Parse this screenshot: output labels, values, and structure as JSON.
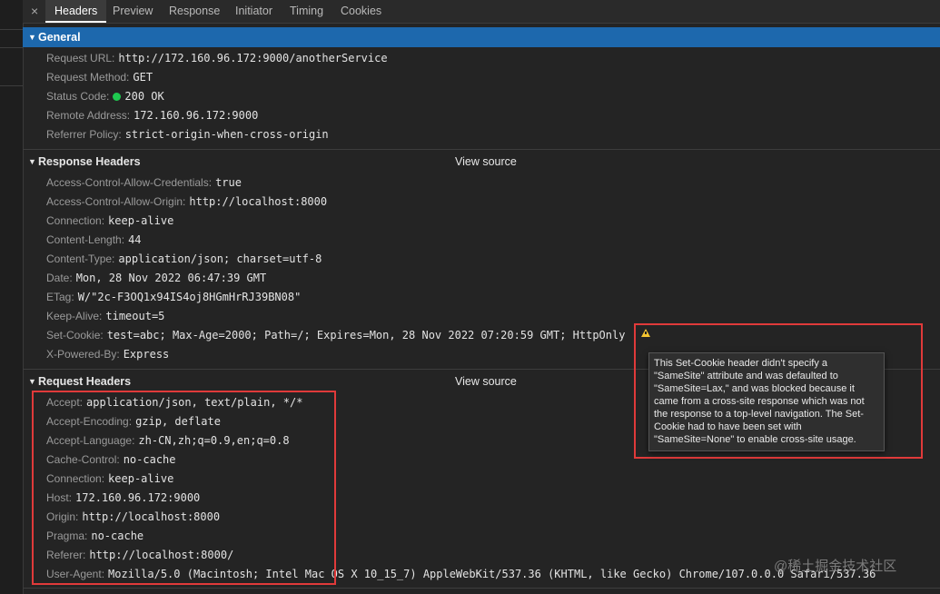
{
  "tabs": {
    "close_symbol": "×",
    "items": [
      "Headers",
      "Preview",
      "Response",
      "Initiator",
      "Timing",
      "Cookies"
    ],
    "active": "Headers"
  },
  "general": {
    "title": "General",
    "rows": [
      {
        "key": "Request URL:",
        "value": "http://172.160.96.172:9000/anotherService"
      },
      {
        "key": "Request Method:",
        "value": "GET"
      },
      {
        "key": "Status Code:",
        "value": "200 OK"
      },
      {
        "key": "Remote Address:",
        "value": "172.160.96.172:9000"
      },
      {
        "key": "Referrer Policy:",
        "value": "strict-origin-when-cross-origin"
      }
    ]
  },
  "response_headers": {
    "title": "Response Headers",
    "view_source": "View source",
    "rows": [
      {
        "key": "Access-Control-Allow-Credentials:",
        "value": "true"
      },
      {
        "key": "Access-Control-Allow-Origin:",
        "value": "http://localhost:8000"
      },
      {
        "key": "Connection:",
        "value": "keep-alive"
      },
      {
        "key": "Content-Length:",
        "value": "44"
      },
      {
        "key": "Content-Type:",
        "value": "application/json; charset=utf-8"
      },
      {
        "key": "Date:",
        "value": "Mon, 28 Nov 2022 06:47:39 GMT"
      },
      {
        "key": "ETag:",
        "value": "W/\"2c-F3OQ1x94IS4oj8HGmHrRJ39BN08\""
      },
      {
        "key": "Keep-Alive:",
        "value": "timeout=5"
      },
      {
        "key": "Set-Cookie:",
        "value": "test=abc; Max-Age=2000; Path=/; Expires=Mon, 28 Nov 2022 07:20:59 GMT; HttpOnly"
      },
      {
        "key": "X-Powered-By:",
        "value": "Express"
      }
    ]
  },
  "request_headers": {
    "title": "Request Headers",
    "view_source": "View source",
    "rows": [
      {
        "key": "Accept:",
        "value": "application/json, text/plain, */*"
      },
      {
        "key": "Accept-Encoding:",
        "value": "gzip, deflate"
      },
      {
        "key": "Accept-Language:",
        "value": "zh-CN,zh;q=0.9,en;q=0.8"
      },
      {
        "key": "Cache-Control:",
        "value": "no-cache"
      },
      {
        "key": "Connection:",
        "value": "keep-alive"
      },
      {
        "key": "Host:",
        "value": "172.160.96.172:9000"
      },
      {
        "key": "Origin:",
        "value": "http://localhost:8000"
      },
      {
        "key": "Pragma:",
        "value": "no-cache"
      },
      {
        "key": "Referer:",
        "value": "http://localhost:8000/"
      },
      {
        "key": "User-Agent:",
        "value": "Mozilla/5.0 (Macintosh; Intel Mac OS X 10_15_7) AppleWebKit/537.36 (KHTML, like Gecko) Chrome/107.0.0.0 Safari/537.36"
      }
    ]
  },
  "tooltip": {
    "text": "This Set-Cookie header didn't specify a \"SameSite\" attribute and was defaulted to \"SameSite=Lax,\" and was blocked because it came from a cross-site response which was not the response to a top-level navigation. The Set-Cookie had to have been set with \"SameSite=None\" to enable cross-site usage."
  },
  "icons": {
    "caret": "caret-down-icon",
    "status": "green-dot-icon",
    "warning": "warning-icon"
  },
  "colors": {
    "accent": "#1d68ad",
    "highlight_box": "#e03a3a",
    "status_ok": "#1ec84f",
    "warning": "#f4c430"
  },
  "watermark": "@稀土掘金技术社区"
}
